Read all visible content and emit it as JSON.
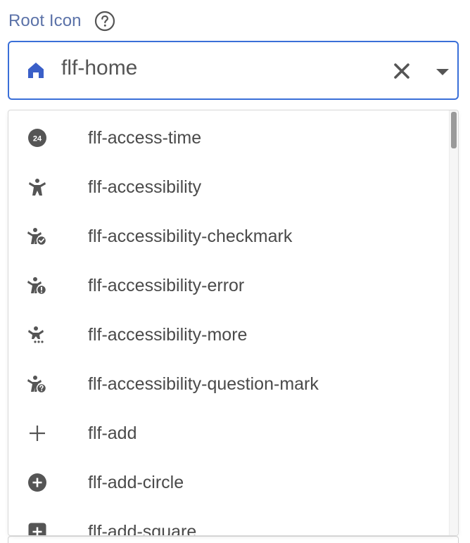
{
  "field": {
    "label": "Root Icon",
    "help_icon": "question-circle-icon",
    "selected_value": "flf-home",
    "selected_icon": "home-icon",
    "clear_icon": "close-icon",
    "dropdown_icon": "caret-down-icon"
  },
  "colors": {
    "label": "#5b72a8",
    "accent": "#3a6fd8",
    "icon": "#555555",
    "text": "#4a4a4a"
  },
  "menu": {
    "items": [
      {
        "label": "flf-access-time",
        "icon": "access-time-icon"
      },
      {
        "label": "flf-accessibility",
        "icon": "accessibility-icon"
      },
      {
        "label": "flf-accessibility-checkmark",
        "icon": "accessibility-checkmark-icon"
      },
      {
        "label": "flf-accessibility-error",
        "icon": "accessibility-error-icon"
      },
      {
        "label": "flf-accessibility-more",
        "icon": "accessibility-more-icon"
      },
      {
        "label": "flf-accessibility-question-mark",
        "icon": "accessibility-question-mark-icon"
      },
      {
        "label": "flf-add",
        "icon": "add-icon"
      },
      {
        "label": "flf-add-circle",
        "icon": "add-circle-icon"
      },
      {
        "label": "flf-add-square",
        "icon": "add-square-icon"
      }
    ]
  }
}
